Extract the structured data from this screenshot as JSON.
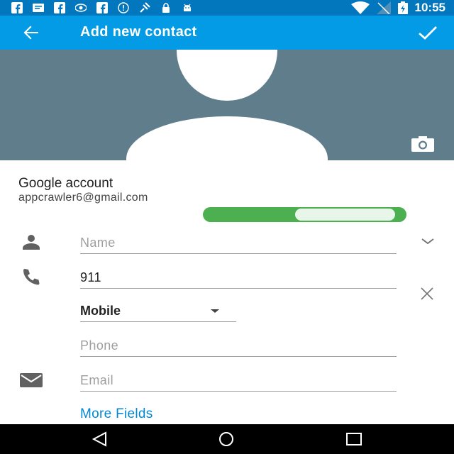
{
  "status_bar": {
    "time": "10:55",
    "icons": [
      "facebook-icon",
      "message-icon",
      "facebook-icon",
      "eye-icon",
      "facebook-icon",
      "alert-icon",
      "satellite-icon",
      "lock-icon",
      "android-icon",
      "wifi-icon",
      "no-signal-icon",
      "battery-charging-icon"
    ]
  },
  "app_bar": {
    "title": "Add new contact",
    "back_icon": "arrow-left-icon",
    "done_icon": "check-icon"
  },
  "photo": {
    "background_color": "#607d8b",
    "camera_icon": "camera-icon"
  },
  "account": {
    "label": "Google account",
    "email": "appcrawler6@gmail.com"
  },
  "toggle": {
    "on": true,
    "color": "#4caf50"
  },
  "fields": {
    "name_placeholder": "Name",
    "phone_value": "911",
    "phone_type": "Mobile",
    "phone_placeholder": "Phone",
    "email_placeholder": "Email"
  },
  "more_fields_label": "More Fields",
  "nav_bar": {
    "back": "triangle-back-icon",
    "home": "circle-home-icon",
    "recents": "square-recents-icon"
  },
  "colors": {
    "status_bar": "#0277bd",
    "app_bar": "#039be5",
    "link": "#0288d1"
  }
}
